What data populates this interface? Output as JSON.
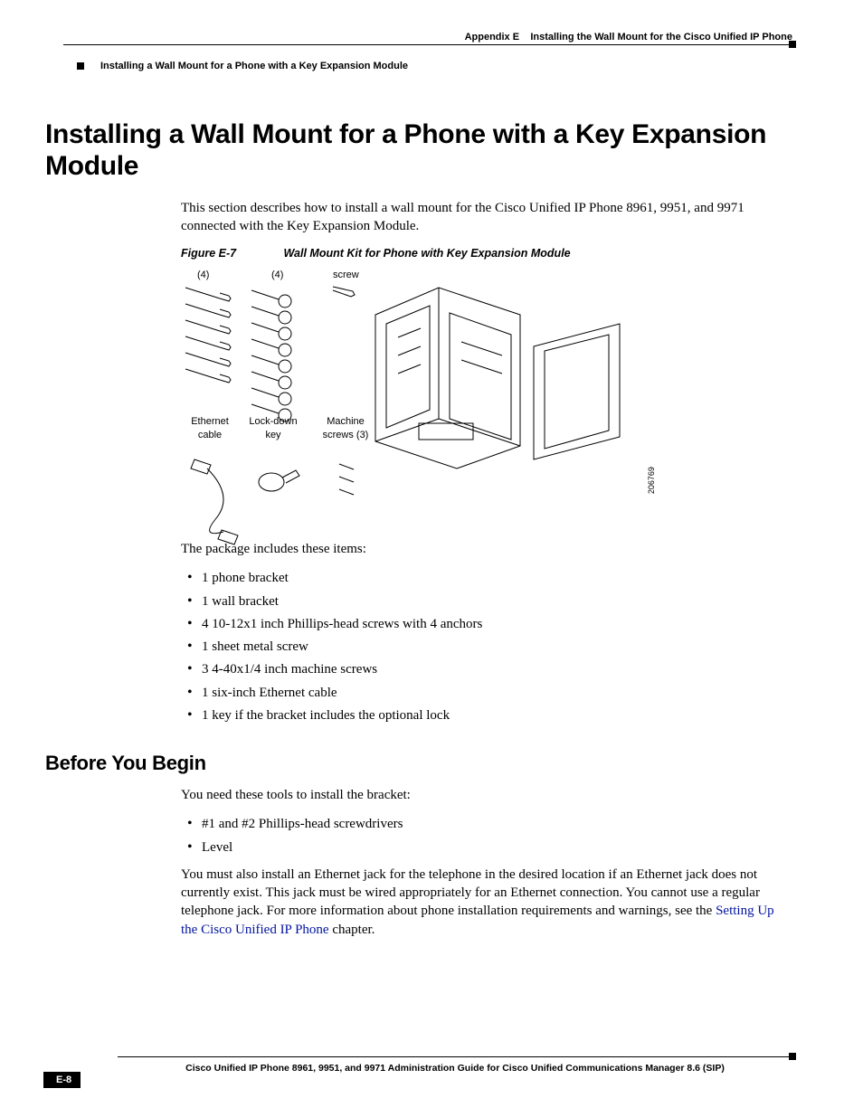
{
  "header": {
    "appendix_label": "Appendix E",
    "appendix_title": "Installing the Wall Mount for the Cisco Unified IP Phone",
    "section_title": "Installing a Wall Mount for a Phone with a Key Expansion Module"
  },
  "title_h1": "Installing a Wall Mount for a Phone with a Key Expansion Module",
  "intro_paragraph": "This section describes how to install a wall mount for the Cisco Unified IP Phone 8961, 9951, and 9971 connected with the Key Expansion Module.",
  "figure": {
    "number": "Figure E-7",
    "caption": "Wall Mount Kit for Phone with Key Expansion Module",
    "labels": {
      "qty_a": "(4)",
      "qty_b": "(4)",
      "screw": "screw",
      "ethernet": "Ethernet cable",
      "lockdown": "Lock-down key",
      "machine": "Machine screws (3)",
      "diagram_id": "206769"
    }
  },
  "package_intro": "The package includes these items:",
  "package_items": [
    "1 phone bracket",
    "1 wall bracket",
    "4 10-12x1 inch Phillips-head screws with 4 anchors",
    "1 sheet metal screw",
    "3 4-40x1/4 inch machine screws",
    "1 six-inch Ethernet cable",
    "1 key if the bracket includes the optional lock"
  ],
  "before_h2": "Before You Begin",
  "tools_intro": "You need these tools to install the bracket:",
  "tools_items": [
    "#1 and #2 Phillips-head screwdrivers",
    "Level"
  ],
  "jack_para_pre": "You must also install an Ethernet jack for the telephone in the desired location if an Ethernet jack does not currently exist. This jack must be wired appropriately for an Ethernet connection. You cannot use a regular telephone jack. For more information about phone installation requirements and warnings, see the ",
  "jack_link": "Setting Up the Cisco Unified IP Phone",
  "jack_para_post": " chapter.",
  "footer": {
    "guide": "Cisco Unified IP Phone 8961, 9951, and 9971 Administration Guide for Cisco Unified Communications Manager 8.6 (SIP)",
    "page": "E-8"
  }
}
